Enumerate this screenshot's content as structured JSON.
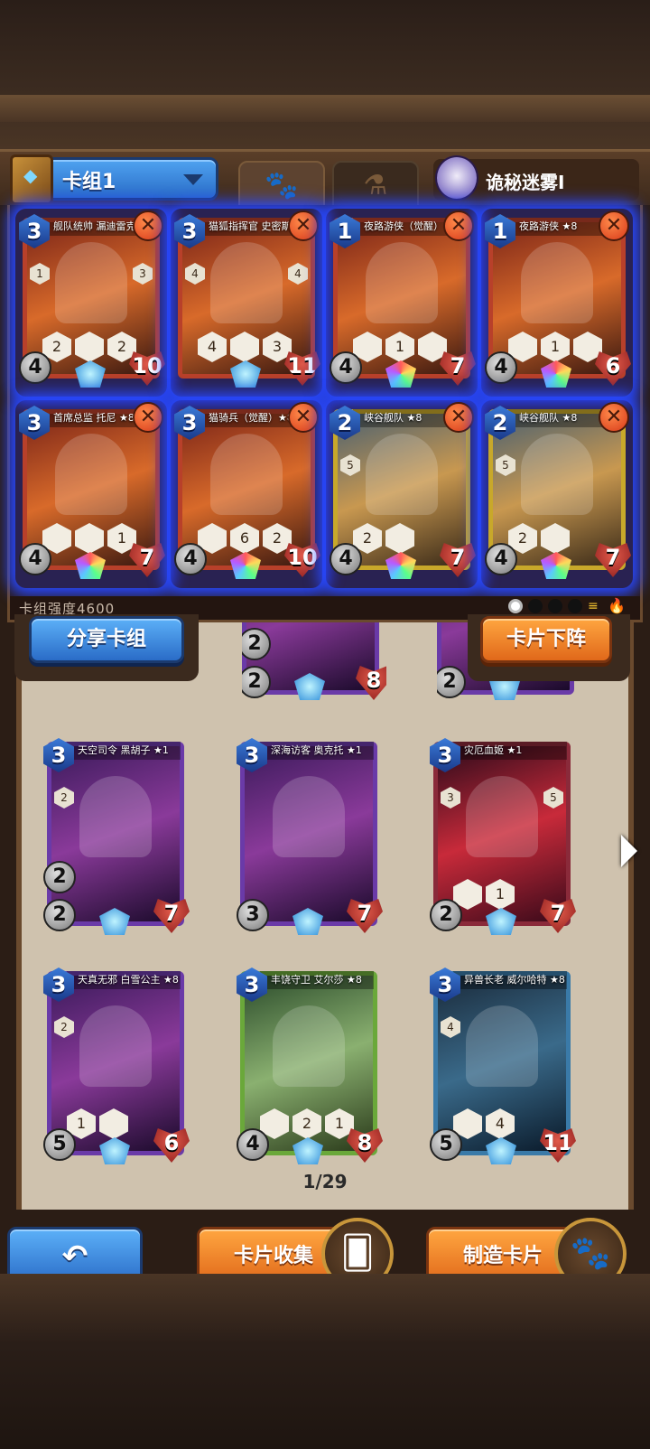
{
  "header": {
    "deck_selector_label": "卡组1",
    "mystery_label": "诡秘迷雾I"
  },
  "deck": {
    "strength_label": "卡组强度4600",
    "cards": [
      {
        "title": "舰队统帅 漏迪雷克 ★8",
        "cost": "3",
        "attack": "4",
        "health": "10",
        "skills": [
          "2",
          "",
          "2"
        ],
        "side_left": "1",
        "side_right": "3",
        "gem": "star",
        "frame": "red"
      },
      {
        "title": "猫狐指挥官 史密斯 ★8",
        "cost": "3",
        "attack": "",
        "health": "11",
        "skills": [
          "4",
          "",
          "3"
        ],
        "side_left": "4",
        "side_right": "4",
        "gem": "star",
        "frame": "red"
      },
      {
        "title": "夜路游侠（觉醒）★8",
        "cost": "1",
        "attack": "4",
        "health": "7",
        "skills": [
          "",
          "1",
          ""
        ],
        "side_left": "",
        "side_right": "",
        "gem": "rainbow",
        "frame": "red"
      },
      {
        "title": "夜路游侠 ★8",
        "cost": "1",
        "attack": "4",
        "health": "6",
        "skills": [
          "",
          "1",
          ""
        ],
        "side_left": "",
        "side_right": "",
        "gem": "rainbow",
        "frame": "red"
      },
      {
        "title": "首席总监 托尼 ★8",
        "cost": "3",
        "attack": "4",
        "health": "7",
        "skills": [
          "",
          "",
          "1"
        ],
        "side_left": "",
        "side_right": "",
        "gem": "rainbow",
        "frame": "red"
      },
      {
        "title": "猫骑兵（觉醒）★8",
        "cost": "3",
        "attack": "4",
        "health": "10",
        "skills": [
          "",
          "6",
          "2"
        ],
        "side_left": "",
        "side_right": "",
        "gem": "rainbow",
        "frame": "red"
      },
      {
        "title": "峡谷舰队 ★8",
        "cost": "2",
        "attack": "4",
        "health": "7",
        "skills": [
          "2",
          ""
        ],
        "side_left": "5",
        "side_right": "",
        "gem": "rainbow",
        "frame": "gold"
      },
      {
        "title": "峡谷舰队 ★8",
        "cost": "2",
        "attack": "4",
        "health": "7",
        "skills": [
          "2",
          ""
        ],
        "side_left": "5",
        "side_right": "",
        "gem": "rainbow",
        "frame": "gold"
      }
    ]
  },
  "actions": {
    "share_deck": "分享卡组",
    "remove_card": "卡片下阵",
    "card_collection": "卡片收集",
    "craft_card": "制造卡片"
  },
  "collection": {
    "partial_top_row": [
      {
        "attack": "2",
        "health": "8",
        "extra": "2"
      },
      {
        "attack": "2",
        "health": "",
        "extra": ""
      }
    ],
    "cards": [
      {
        "title": "天空司令 黑胡子 ★1",
        "cost": "3",
        "attack": "2",
        "health": "7",
        "left_stat": "2",
        "side_left": "2",
        "side_right": "",
        "frame": "purple"
      },
      {
        "title": "深海访客 奥克托 ★1",
        "cost": "3",
        "attack": "3",
        "health": "7",
        "left_stat": "",
        "side_left": "",
        "side_right": "",
        "frame": "purple"
      },
      {
        "title": "灾厄血姬 ★1",
        "cost": "3",
        "attack": "2",
        "health": "7",
        "left_stat": "",
        "side_left": "3",
        "side_right": "5",
        "frame": "redpurple",
        "skills": [
          "",
          "1"
        ]
      },
      {
        "title": "天真无邪 白雪公主 ★8",
        "cost": "3",
        "attack": "5",
        "health": "6",
        "left_stat": "",
        "side_left": "2",
        "side_right": "",
        "frame": "purple",
        "skills": [
          "1",
          ""
        ]
      },
      {
        "title": "丰饶守卫 艾尔莎 ★8",
        "cost": "3",
        "attack": "4",
        "health": "8",
        "left_stat": "",
        "side_left": "",
        "side_right": "",
        "frame": "green",
        "skills": [
          "",
          "2",
          "1"
        ]
      },
      {
        "title": "异兽长老 威尔哈特 ★8",
        "cost": "3",
        "attack": "5",
        "health": "11",
        "left_stat": "",
        "side_left": "4",
        "side_right": "",
        "frame": "teal",
        "skills": [
          "",
          "4"
        ]
      }
    ],
    "page_indicator": "1/29"
  },
  "colors": {
    "blue_button": "#2a6cc7",
    "orange_button": "#e0681a",
    "deck_glow": "#2848ff"
  }
}
